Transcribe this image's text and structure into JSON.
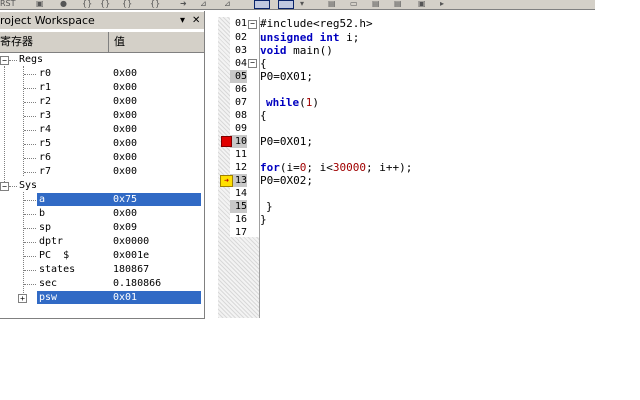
{
  "toolbar": {
    "rst_label": "RST"
  },
  "workspace": {
    "title": "roject Workspace",
    "col_register": "寄存器",
    "col_value": "值",
    "regs_group": "Regs",
    "sys_group": "Sys",
    "regs": [
      {
        "name": "r0",
        "value": "0x00"
      },
      {
        "name": "r1",
        "value": "0x00"
      },
      {
        "name": "r2",
        "value": "0x00"
      },
      {
        "name": "r3",
        "value": "0x00"
      },
      {
        "name": "r4",
        "value": "0x00"
      },
      {
        "name": "r5",
        "value": "0x00"
      },
      {
        "name": "r6",
        "value": "0x00"
      },
      {
        "name": "r7",
        "value": "0x00"
      }
    ],
    "sys": [
      {
        "name": "a",
        "value": "0x75"
      },
      {
        "name": "b",
        "value": "0x00"
      },
      {
        "name": "sp",
        "value": "0x09"
      },
      {
        "name": "dptr",
        "value": "0x0000"
      },
      {
        "name": "PC  $",
        "value": "0x001e"
      },
      {
        "name": "states",
        "value": "180867"
      },
      {
        "name": "sec",
        "value": "0.180866"
      },
      {
        "name": "psw",
        "value": "0x01"
      }
    ]
  },
  "editor": {
    "line_numbers": [
      "01",
      "02",
      "03",
      "04",
      "05",
      "06",
      "07",
      "08",
      "09",
      "10",
      "11",
      "12",
      "13",
      "14",
      "15",
      "16",
      "17"
    ],
    "l01": "#include<reg52.h>",
    "l02_kw1": "unsigned",
    "l02_kw2": "int",
    "l02_rest": " i;",
    "l03_kw": "void",
    "l03_rest": " main()",
    "l04": "{",
    "l05": "P0=0X01;",
    "l07_kw": "while",
    "l07_p1": "(",
    "l07_num": "1",
    "l07_p2": ")",
    "l08": "{",
    "l10": "P0=0X01;",
    "l12_kw": "for",
    "l12_a": "(i=",
    "l12_n1": "0",
    "l12_b": "; i<",
    "l12_n2": "30000",
    "l12_c": "; i++);",
    "l13": "P0=0X02;",
    "l15": "}",
    "l16": "}"
  }
}
